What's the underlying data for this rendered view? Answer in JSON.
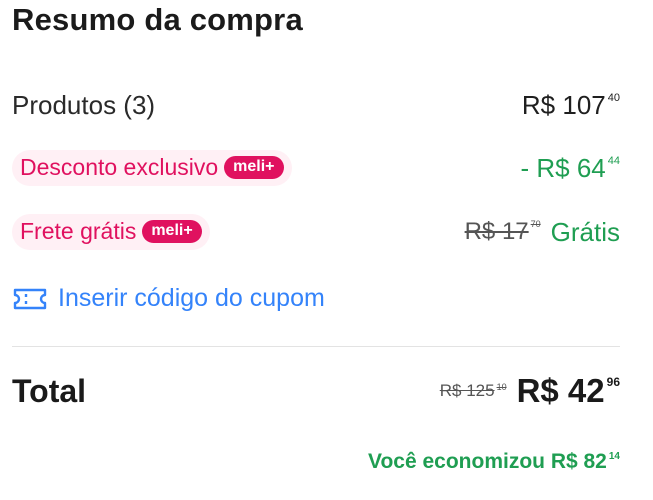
{
  "summary": {
    "title": "Resumo da compra",
    "products": {
      "label": "Produtos (3)",
      "price_main": "R$ 107",
      "price_cents": "40"
    },
    "discount": {
      "label": "Desconto exclusivo",
      "badge": "meli+",
      "price_main": "- R$ 64",
      "price_cents": "44"
    },
    "shipping": {
      "label": "Frete grátis",
      "badge": "meli+",
      "old_main": "R$ 17",
      "old_cents": "70",
      "free_text": "Grátis"
    },
    "coupon": {
      "label": "Inserir código do cupom",
      "icon": "coupon-ticket-icon"
    },
    "total": {
      "label": "Total",
      "old_main": "R$ 125",
      "old_cents": "10",
      "price_main": "R$ 42",
      "price_cents": "96"
    },
    "savings": {
      "text_main": "Você economizou R$ 82",
      "text_cents": "14"
    }
  },
  "colors": {
    "accent_pink": "#e0115f",
    "pill_bg": "#fff0f5",
    "green": "#1f9e52",
    "link_blue": "#3483fa"
  }
}
